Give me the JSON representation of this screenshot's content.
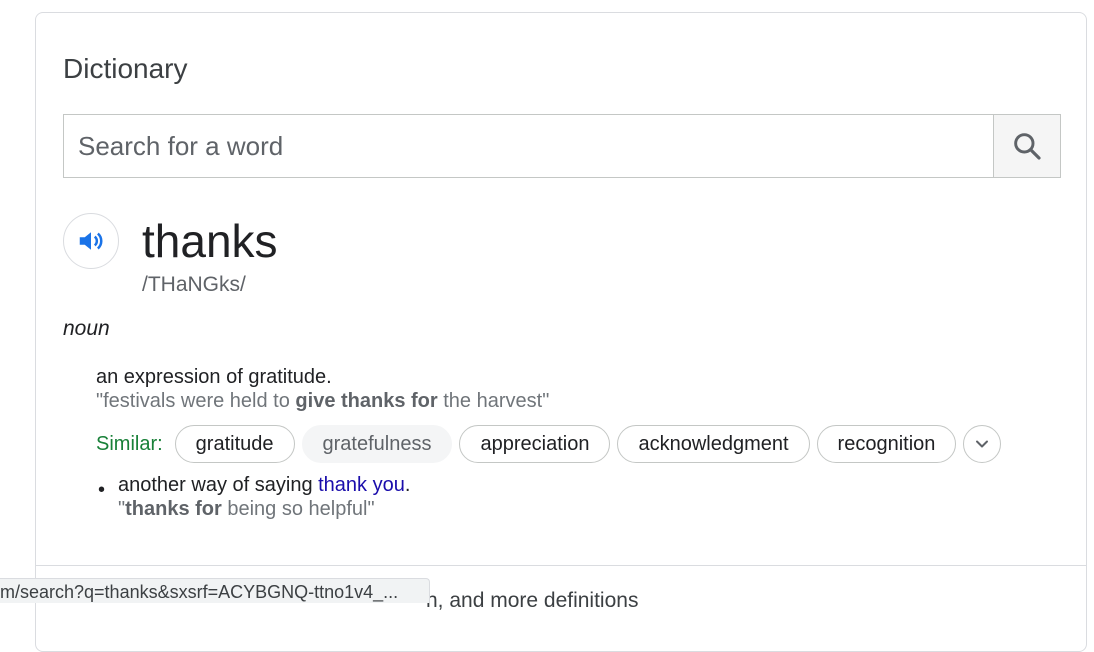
{
  "card": {
    "title": "Dictionary",
    "search": {
      "placeholder": "Search for a word"
    },
    "entry": {
      "word": "thanks",
      "phonetic": "/THaNGks/",
      "part_of_speech": "noun",
      "sense1": {
        "definition": "an expression of gratitude.",
        "example_pre": "\"festivals were held to ",
        "example_bold": "give thanks for",
        "example_post": " the harvest\"",
        "similar_label": "Similar:",
        "similar": [
          "gratitude",
          "gratefulness",
          "appreciation",
          "acknowledgment",
          "recognition"
        ]
      },
      "sense2": {
        "definition_pre": "another way of saying ",
        "definition_link": "thank you",
        "definition_post": ".",
        "example_pre": "\"",
        "example_bold": "thanks for",
        "example_post": " being so helpful\""
      }
    },
    "more_text": "n, and more definitions"
  },
  "status_bar": {
    "url": "m/search?q=thanks&sxsrf=ACYBGNQ-ttno1v4_..."
  },
  "icons": {
    "search": "search-icon",
    "speaker": "speaker-icon",
    "expand": "chevron-down-icon"
  },
  "colors": {
    "accent": "#1a73e8",
    "similar_label": "#188038",
    "link": "#1a0dab"
  }
}
